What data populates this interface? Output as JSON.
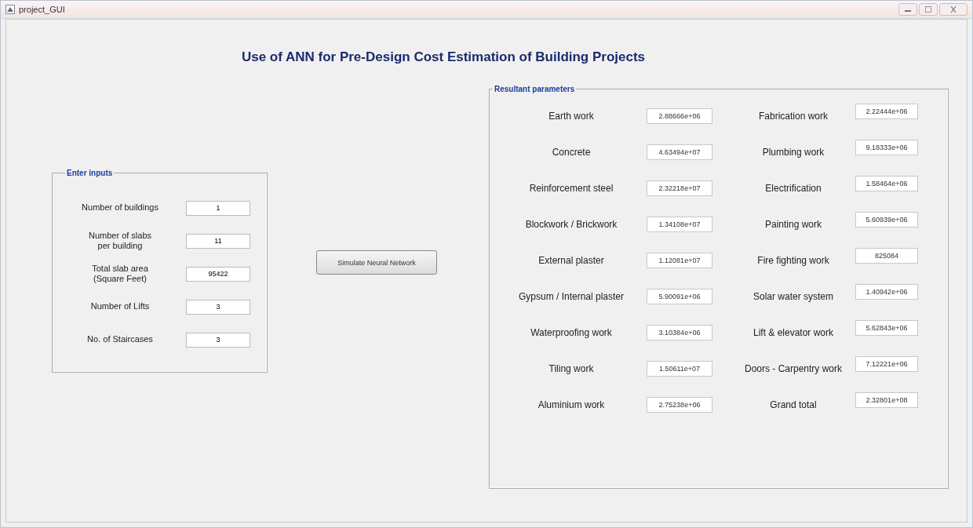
{
  "window": {
    "title": "project_GUI"
  },
  "heading": "Use of ANN for Pre-Design Cost Estimation of Building Projects",
  "inputs": {
    "title": "Enter inputs",
    "fields": [
      {
        "label": "Number of buildings",
        "value": "1"
      },
      {
        "label": "Number of slabs\nper building",
        "value": "11"
      },
      {
        "label": "Total slab area\n(Square Feet)",
        "value": "95422"
      },
      {
        "label": "Number of Lifts",
        "value": "3"
      },
      {
        "label": "No. of Staircases",
        "value": "3"
      }
    ]
  },
  "simulate_button": "Simulate Neural Network",
  "results": {
    "title": "Resultant parameters",
    "columns": [
      [
        {
          "label": "Earth work",
          "value": "2.88666e+06"
        },
        {
          "label": "Concrete",
          "value": "4.63494e+07"
        },
        {
          "label": "Reinforcement steel",
          "value": "2.32218e+07"
        },
        {
          "label": "Blockwork / Brickwork",
          "value": "1.34108e+07"
        },
        {
          "label": "External plaster",
          "value": "1.12081e+07"
        },
        {
          "label": "Gypsum / Internal plaster",
          "value": "5.90091e+06"
        },
        {
          "label": "Waterproofing work",
          "value": "3.10384e+06"
        },
        {
          "label": "Tiling work",
          "value": "1.50611e+07"
        },
        {
          "label": "Aluminium work",
          "value": "2.75238e+06"
        }
      ],
      [
        {
          "label": "Fabrication work",
          "value": "2.22444e+06"
        },
        {
          "label": "Plumbing work",
          "value": "9.18333e+06"
        },
        {
          "label": "Electrification",
          "value": "1.58464e+06"
        },
        {
          "label": "Painting work",
          "value": "5.60939e+06"
        },
        {
          "label": "Fire fighting work",
          "value": "825084"
        },
        {
          "label": "Solar water system",
          "value": "1.40942e+06"
        },
        {
          "label": "Lift & elevator work",
          "value": "5.62843e+06"
        },
        {
          "label": "Doors - Carpentry work",
          "value": "7.12221e+06"
        },
        {
          "label": "Grand total",
          "value": "2.32801e+08"
        }
      ]
    ]
  }
}
